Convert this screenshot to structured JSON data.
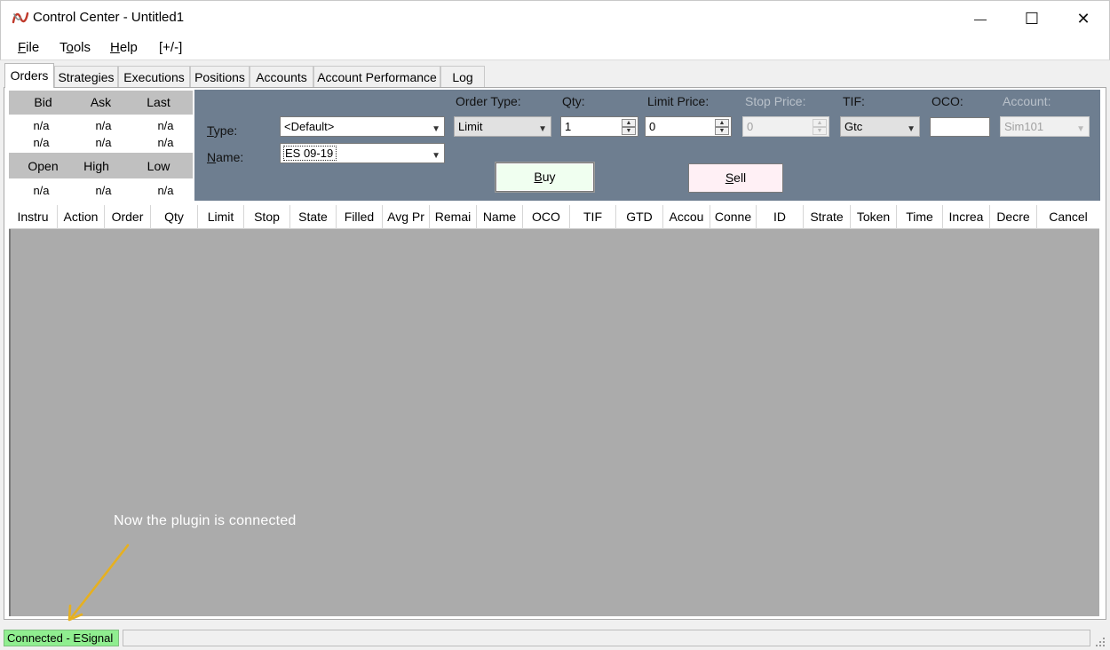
{
  "window": {
    "title": "Control Center - Untitled1",
    "minimize_glyph": "—",
    "maximize_glyph": "☐",
    "close_glyph": "✕"
  },
  "menu": {
    "file": {
      "u": "F",
      "rest": "ile"
    },
    "tools": {
      "pre": "T",
      "u": "o",
      "rest": "ols"
    },
    "help": {
      "u": "H",
      "rest": "elp"
    },
    "toggle": "[+/-]"
  },
  "tabs": [
    "Orders",
    "Strategies",
    "Executions",
    "Positions",
    "Accounts",
    "Account Performance",
    "Log"
  ],
  "market": {
    "headers": [
      "Bid",
      "Ask",
      "Last"
    ],
    "row1": [
      "n/a",
      "n/a",
      "n/a"
    ],
    "row2": [
      "n/a",
      "n/a",
      "n/a"
    ],
    "headers2": [
      "Open",
      "High",
      "Low"
    ],
    "row3": [
      "n/a",
      "n/a",
      "n/a"
    ]
  },
  "order_entry": {
    "type_label": {
      "u": "T",
      "rest": "ype:"
    },
    "name_label": {
      "u": "N",
      "rest": "ame:"
    },
    "type_value": "<Default>",
    "name_value": "ES 09-19",
    "order_type_label": "Order Type:",
    "order_type_value": "Limit",
    "qty_label": "Qty:",
    "qty_value": "1",
    "limit_price_label": "Limit Price:",
    "limit_price_value": "0",
    "stop_price_label": "Stop Price:",
    "stop_price_value": "0",
    "tif_label": "TIF:",
    "tif_value": "Gtc",
    "oco_label": "OCO:",
    "oco_value": "",
    "account_label": "Account:",
    "account_value": "Sim101",
    "buy": {
      "u": "B",
      "rest": "uy"
    },
    "sell": {
      "u": "S",
      "rest": "ell"
    }
  },
  "grid_columns": [
    "Instru",
    "Action",
    "Order",
    "Qty",
    "Limit",
    "Stop",
    "State",
    "Filled",
    "Avg Pr",
    "Remai",
    "Name",
    "OCO",
    "TIF",
    "GTD",
    "Accou",
    "Conne",
    "ID",
    "Strate",
    "Token",
    "Time",
    "Increa",
    "Decre",
    "Cancel"
  ],
  "annotation": "Now the plugin is connected",
  "status": {
    "connection": "Connected - ESignal"
  },
  "colors": {
    "order_panel": "#6e7e90",
    "grid_body": "#ababab",
    "connected": "#90ee90",
    "buy_button": "#f0fff0",
    "sell_button": "#fff0f5",
    "arrow": "#e6b020"
  },
  "icons": {
    "app": "app-logo-icon",
    "dropdown": "chevron-down-icon",
    "spin": "spin-arrows-icon",
    "grip": "resize-grip-icon"
  }
}
